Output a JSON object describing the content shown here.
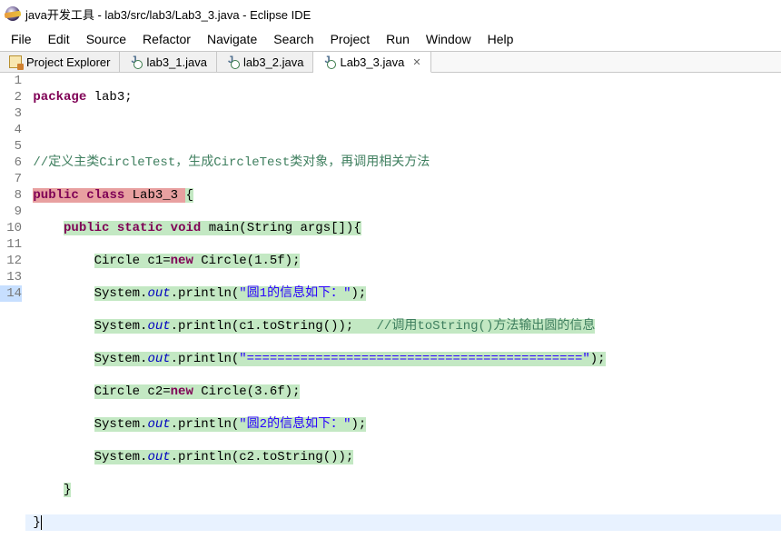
{
  "window": {
    "title": "java开发工具 - lab3/src/lab3/Lab3_3.java - Eclipse IDE"
  },
  "menu": {
    "items": [
      "File",
      "Edit",
      "Source",
      "Refactor",
      "Navigate",
      "Search",
      "Project",
      "Run",
      "Window",
      "Help"
    ]
  },
  "tabs": {
    "items": [
      {
        "label": "Project Explorer",
        "kind": "view"
      },
      {
        "label": "lab3_1.java",
        "kind": "java"
      },
      {
        "label": "lab3_2.java",
        "kind": "java"
      },
      {
        "label": "Lab3_3.java",
        "kind": "java",
        "active": true
      }
    ]
  },
  "code": {
    "tokens": {
      "package": "package",
      "lab3": "lab3",
      "semicolon": ";",
      "comment_class": "//定义主类CircleTest，生成CircleTest类对象，再调用相关方法",
      "public": "public",
      "class": "class",
      "Lab3_3": "Lab3_3",
      "lbrace": "{",
      "rbrace": "}",
      "static": "static",
      "void": "void",
      "main": "main",
      "string_args": "(String args[]){",
      "circle_c1": "Circle c1=",
      "new": "new",
      "circle15": " Circle(1.5f);",
      "system": "System.",
      "out": "out",
      "println": ".println(",
      "str_info1": "\"圆1的信息如下：\"",
      "close_paren": ");",
      "c1_tostring": "c1.toString());",
      "comment_tostring": "//调用toString()方法输出圆的信息",
      "str_divider": "\"============================================\"",
      "circle_c2": "Circle c2=",
      "circle36": " Circle(3.6f);",
      "str_info2": "\"圆2的信息如下：\"",
      "c2_tostring": "c2.toString());"
    },
    "line_numbers": [
      "1",
      "2",
      "3",
      "4",
      "5",
      "6",
      "7",
      "8",
      "9",
      "10",
      "11",
      "12",
      "13",
      "14"
    ]
  }
}
